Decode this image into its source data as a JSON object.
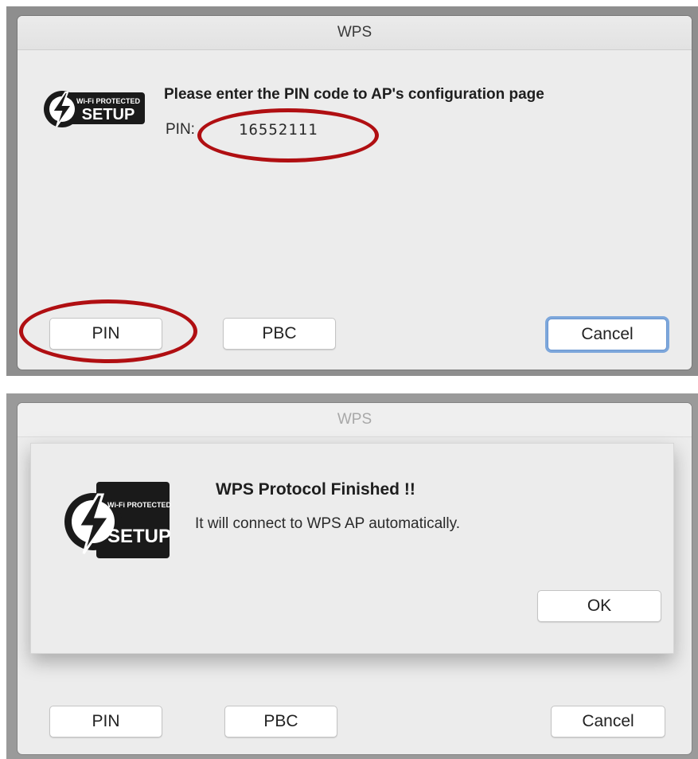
{
  "top_dialog": {
    "title": "WPS",
    "logo_small_text": "Wi-Fi PROTECTED",
    "logo_big_text": "SETUP",
    "heading": "Please enter the PIN code to AP's configuration page",
    "pin_label": "PIN:",
    "pin_value": "16552111",
    "buttons": {
      "pin": "PIN",
      "pbc": "PBC",
      "cancel": "Cancel"
    }
  },
  "bottom_dialog": {
    "title": "WPS",
    "alert": {
      "logo_small_text": "Wi-Fi PROTECTED",
      "logo_big_text": "SETUP",
      "heading": "WPS Protocol Finished !!",
      "message": "It will connect to WPS AP automatically.",
      "ok": "OK"
    },
    "buttons": {
      "pin": "PIN",
      "pbc": "PBC",
      "cancel": "Cancel"
    }
  },
  "colors": {
    "annotation": "#b00f12",
    "focus_ring": "#7da7db",
    "window_bg": "#ececec",
    "backdrop": "#8e8e8e"
  },
  "icons": {
    "wps_logo": "wifi-protected-setup-logo"
  }
}
